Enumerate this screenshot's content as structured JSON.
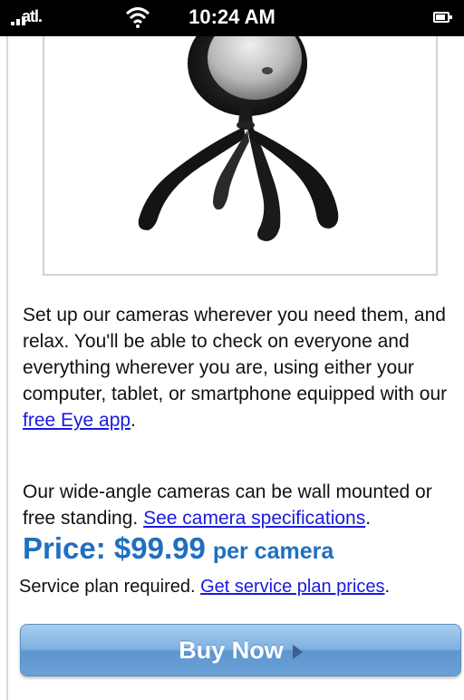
{
  "status_bar": {
    "carrier": "atl.",
    "time": "10:24 AM"
  },
  "product_image": {
    "icon": "webcam-image"
  },
  "description": {
    "paragraph1_text": "Set up our cameras wherever you need them, and relax.  You'll be able to check on everyone and everything wherever you are, using either your computer, tablet, or smartphone equipped with our ",
    "paragraph1_link": "free Eye app",
    "paragraph1_end": ".",
    "paragraph2_text": "Our wide-angle cameras can be wall mounted or free standing.  ",
    "paragraph2_link": "See camera specifications",
    "paragraph2_end": "."
  },
  "price": {
    "main": "Price: $99.99",
    "unit": "per camera"
  },
  "service": {
    "text": "Service plan required. ",
    "link": "Get service plan prices",
    "end": "."
  },
  "buy": {
    "label": "Buy Now"
  },
  "colors": {
    "price": "#1f6fbf",
    "link": "#1a1add",
    "button": "#7fb1e1"
  }
}
